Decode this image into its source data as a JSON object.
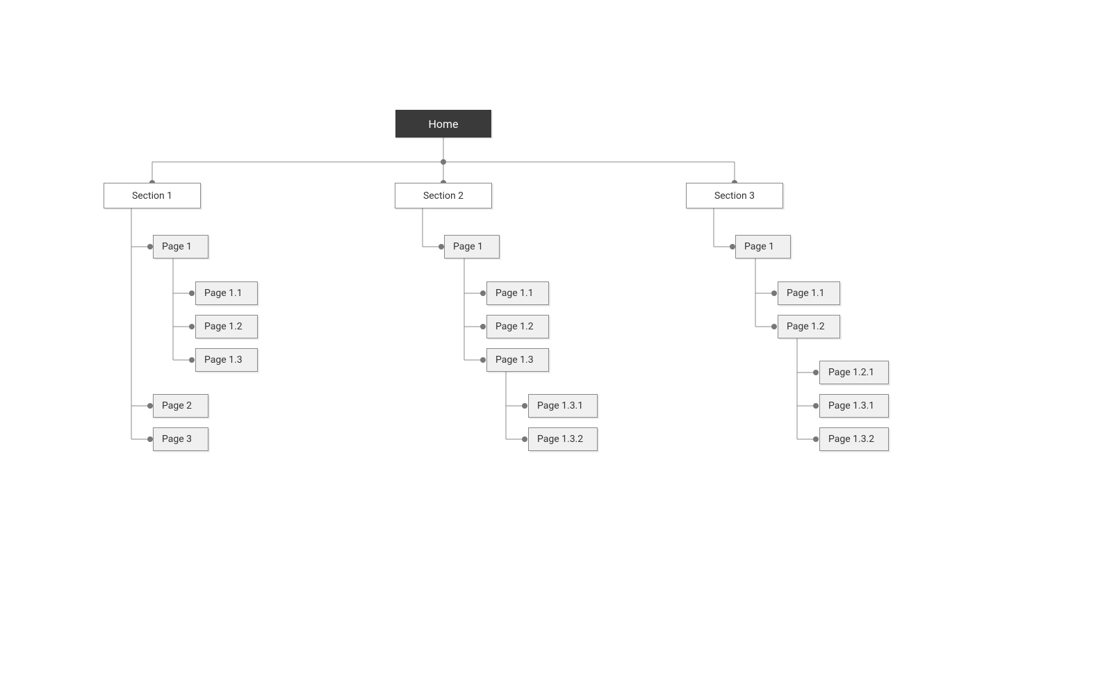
{
  "root": {
    "label": "Home"
  },
  "sections": [
    {
      "label": "Section 1",
      "children": [
        {
          "label": "Page 1",
          "children": [
            {
              "label": "Page 1.1"
            },
            {
              "label": "Page 1.2"
            },
            {
              "label": "Page 1.3"
            }
          ]
        },
        {
          "label": "Page 2"
        },
        {
          "label": "Page 3"
        }
      ]
    },
    {
      "label": "Section 2",
      "children": [
        {
          "label": "Page 1",
          "children": [
            {
              "label": "Page 1.1"
            },
            {
              "label": "Page 1.2"
            },
            {
              "label": "Page 1.3",
              "children": [
                {
                  "label": "Page 1.3.1"
                },
                {
                  "label": "Page 1.3.2"
                }
              ]
            }
          ]
        }
      ]
    },
    {
      "label": "Section 3",
      "children": [
        {
          "label": "Page 1",
          "children": [
            {
              "label": "Page 1.1"
            },
            {
              "label": "Page 1.2",
              "children": [
                {
                  "label": "Page 1.2.1"
                },
                {
                  "label": "Page 1.3.1"
                },
                {
                  "label": "Page 1.3.2"
                }
              ]
            }
          ]
        }
      ]
    }
  ]
}
